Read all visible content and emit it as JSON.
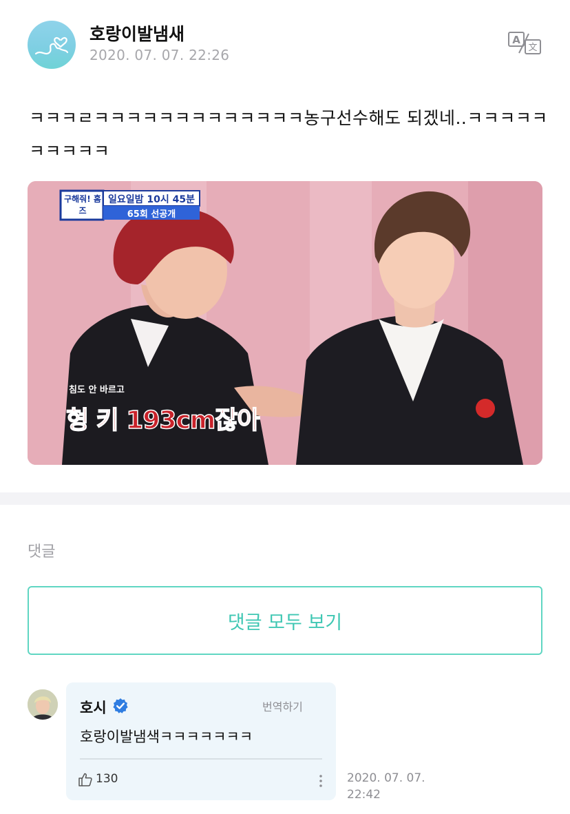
{
  "post": {
    "author": "호랑이발냄새",
    "timestamp": "2020. 07. 07. 22:26",
    "text": "ㅋㅋㅋㄹㅋㅋㅋㅋㅋㅋㅋㅋㅋㅋㅋㅋㅋ농구선수해도 되겠네..ㅋㅋㅋㅋㅋㅋㅋㅋㅋㅋ",
    "translate_icon": "translate-icon",
    "image": {
      "badge_title": "구해줘! 홈즈",
      "badge_time": "일요일밤 10시 45분",
      "badge_episode": "65회 선공개",
      "caption_small": "침도 안 바르고",
      "caption_big": "형 키 193cm잖아"
    }
  },
  "comments": {
    "section_label": "댓글",
    "view_all_label": "댓글 모두 보기",
    "items": [
      {
        "author": "호시",
        "verified_icon": "verified-check-icon",
        "translate_label": "번역하기",
        "text": "호랑이발냄색ㅋㅋㅋㅋㅋㅋㅋ",
        "likes": "130",
        "time_date": "2020. 07. 07.",
        "time_clock": "22:42"
      }
    ]
  },
  "colors": {
    "accent": "#3fc7b3",
    "bubble": "#eef6fb",
    "verified": "#2f7de1"
  }
}
